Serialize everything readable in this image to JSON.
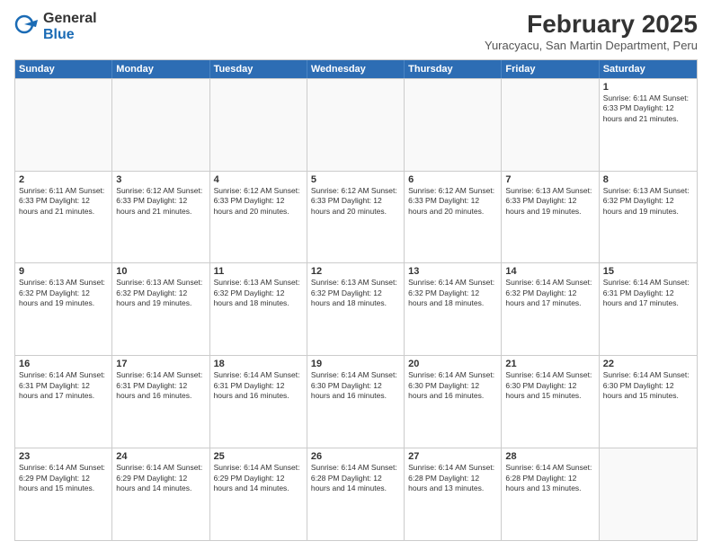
{
  "header": {
    "logo_general": "General",
    "logo_blue": "Blue",
    "main_title": "February 2025",
    "sub_title": "Yuracyacu, San Martin Department, Peru"
  },
  "days_of_week": [
    "Sunday",
    "Monday",
    "Tuesday",
    "Wednesday",
    "Thursday",
    "Friday",
    "Saturday"
  ],
  "weeks": [
    [
      {
        "day": "",
        "info": ""
      },
      {
        "day": "",
        "info": ""
      },
      {
        "day": "",
        "info": ""
      },
      {
        "day": "",
        "info": ""
      },
      {
        "day": "",
        "info": ""
      },
      {
        "day": "",
        "info": ""
      },
      {
        "day": "1",
        "info": "Sunrise: 6:11 AM\nSunset: 6:33 PM\nDaylight: 12 hours and 21 minutes."
      }
    ],
    [
      {
        "day": "2",
        "info": "Sunrise: 6:11 AM\nSunset: 6:33 PM\nDaylight: 12 hours and 21 minutes."
      },
      {
        "day": "3",
        "info": "Sunrise: 6:12 AM\nSunset: 6:33 PM\nDaylight: 12 hours and 21 minutes."
      },
      {
        "day": "4",
        "info": "Sunrise: 6:12 AM\nSunset: 6:33 PM\nDaylight: 12 hours and 20 minutes."
      },
      {
        "day": "5",
        "info": "Sunrise: 6:12 AM\nSunset: 6:33 PM\nDaylight: 12 hours and 20 minutes."
      },
      {
        "day": "6",
        "info": "Sunrise: 6:12 AM\nSunset: 6:33 PM\nDaylight: 12 hours and 20 minutes."
      },
      {
        "day": "7",
        "info": "Sunrise: 6:13 AM\nSunset: 6:33 PM\nDaylight: 12 hours and 19 minutes."
      },
      {
        "day": "8",
        "info": "Sunrise: 6:13 AM\nSunset: 6:32 PM\nDaylight: 12 hours and 19 minutes."
      }
    ],
    [
      {
        "day": "9",
        "info": "Sunrise: 6:13 AM\nSunset: 6:32 PM\nDaylight: 12 hours and 19 minutes."
      },
      {
        "day": "10",
        "info": "Sunrise: 6:13 AM\nSunset: 6:32 PM\nDaylight: 12 hours and 19 minutes."
      },
      {
        "day": "11",
        "info": "Sunrise: 6:13 AM\nSunset: 6:32 PM\nDaylight: 12 hours and 18 minutes."
      },
      {
        "day": "12",
        "info": "Sunrise: 6:13 AM\nSunset: 6:32 PM\nDaylight: 12 hours and 18 minutes."
      },
      {
        "day": "13",
        "info": "Sunrise: 6:14 AM\nSunset: 6:32 PM\nDaylight: 12 hours and 18 minutes."
      },
      {
        "day": "14",
        "info": "Sunrise: 6:14 AM\nSunset: 6:32 PM\nDaylight: 12 hours and 17 minutes."
      },
      {
        "day": "15",
        "info": "Sunrise: 6:14 AM\nSunset: 6:31 PM\nDaylight: 12 hours and 17 minutes."
      }
    ],
    [
      {
        "day": "16",
        "info": "Sunrise: 6:14 AM\nSunset: 6:31 PM\nDaylight: 12 hours and 17 minutes."
      },
      {
        "day": "17",
        "info": "Sunrise: 6:14 AM\nSunset: 6:31 PM\nDaylight: 12 hours and 16 minutes."
      },
      {
        "day": "18",
        "info": "Sunrise: 6:14 AM\nSunset: 6:31 PM\nDaylight: 12 hours and 16 minutes."
      },
      {
        "day": "19",
        "info": "Sunrise: 6:14 AM\nSunset: 6:30 PM\nDaylight: 12 hours and 16 minutes."
      },
      {
        "day": "20",
        "info": "Sunrise: 6:14 AM\nSunset: 6:30 PM\nDaylight: 12 hours and 16 minutes."
      },
      {
        "day": "21",
        "info": "Sunrise: 6:14 AM\nSunset: 6:30 PM\nDaylight: 12 hours and 15 minutes."
      },
      {
        "day": "22",
        "info": "Sunrise: 6:14 AM\nSunset: 6:30 PM\nDaylight: 12 hours and 15 minutes."
      }
    ],
    [
      {
        "day": "23",
        "info": "Sunrise: 6:14 AM\nSunset: 6:29 PM\nDaylight: 12 hours and 15 minutes."
      },
      {
        "day": "24",
        "info": "Sunrise: 6:14 AM\nSunset: 6:29 PM\nDaylight: 12 hours and 14 minutes."
      },
      {
        "day": "25",
        "info": "Sunrise: 6:14 AM\nSunset: 6:29 PM\nDaylight: 12 hours and 14 minutes."
      },
      {
        "day": "26",
        "info": "Sunrise: 6:14 AM\nSunset: 6:28 PM\nDaylight: 12 hours and 14 minutes."
      },
      {
        "day": "27",
        "info": "Sunrise: 6:14 AM\nSunset: 6:28 PM\nDaylight: 12 hours and 13 minutes."
      },
      {
        "day": "28",
        "info": "Sunrise: 6:14 AM\nSunset: 6:28 PM\nDaylight: 12 hours and 13 minutes."
      },
      {
        "day": "",
        "info": ""
      }
    ]
  ]
}
